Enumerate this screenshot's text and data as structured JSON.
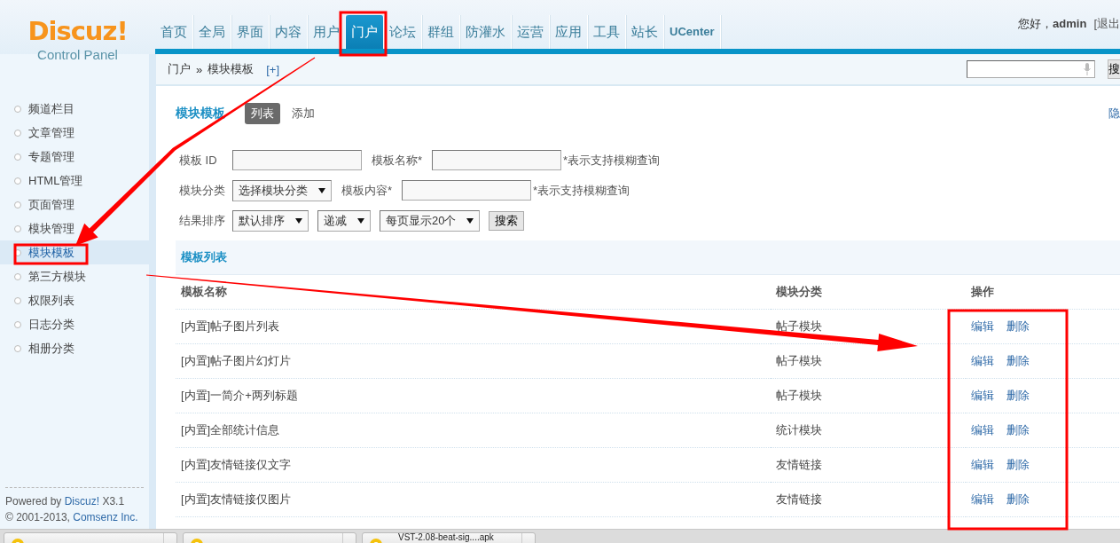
{
  "logo": {
    "title": "Discuz!",
    "subtitle": "Control Panel"
  },
  "nav": [
    {
      "label": "首页",
      "selected": false
    },
    {
      "label": "全局",
      "selected": false
    },
    {
      "label": "界面",
      "selected": false
    },
    {
      "label": "内容",
      "selected": false
    },
    {
      "label": "用户",
      "selected": false
    },
    {
      "label": "门户",
      "selected": true
    },
    {
      "label": "论坛",
      "selected": false
    },
    {
      "label": "群组",
      "selected": false
    },
    {
      "label": "防灌水",
      "selected": false
    },
    {
      "label": "运营",
      "selected": false
    },
    {
      "label": "应用",
      "selected": false
    },
    {
      "label": "工具",
      "selected": false
    },
    {
      "label": "站长",
      "selected": false
    },
    {
      "label": "UCenter",
      "selected": false
    }
  ],
  "user": {
    "greeting": "您好，",
    "name": "admin",
    "logout": "[退出"
  },
  "breadcrumb": {
    "items": [
      "门户",
      "模块模板"
    ],
    "separator": "»",
    "add": "[+]"
  },
  "top_search": {
    "button": "搜"
  },
  "sidebar": {
    "items": [
      {
        "label": "频道栏目",
        "selected": false
      },
      {
        "label": "文章管理",
        "selected": false
      },
      {
        "label": "专题管理",
        "selected": false
      },
      {
        "label": "HTML管理",
        "selected": false
      },
      {
        "label": "页面管理",
        "selected": false
      },
      {
        "label": "模块管理",
        "selected": false
      },
      {
        "label": "模块模板",
        "selected": true
      },
      {
        "label": "第三方模块",
        "selected": false
      },
      {
        "label": "权限列表",
        "selected": false
      },
      {
        "label": "日志分类",
        "selected": false
      },
      {
        "label": "相册分类",
        "selected": false
      }
    ],
    "footer": {
      "powered": "Powered by ",
      "product": "Discuz!",
      "version": " X3.1",
      "copyright": "© 2001-2013, ",
      "company": "Comsenz Inc."
    }
  },
  "page": {
    "title": "模块模板",
    "tabs": [
      {
        "label": "列表",
        "selected": true
      },
      {
        "label": "添加",
        "selected": false
      }
    ],
    "side_link": "隐"
  },
  "filters": [
    {
      "fields": [
        {
          "kind": "label",
          "text": "模板 ID"
        },
        {
          "kind": "input"
        },
        {
          "kind": "label",
          "text": "模板名称*"
        },
        {
          "kind": "input"
        },
        {
          "kind": "hint",
          "text": "*表示支持模糊查询"
        }
      ]
    },
    {
      "fields": [
        {
          "kind": "label",
          "text": "模块分类"
        },
        {
          "kind": "select",
          "value": "选择模块分类"
        },
        {
          "kind": "label",
          "text": "模板内容*"
        },
        {
          "kind": "input"
        },
        {
          "kind": "hint",
          "text": "*表示支持模糊查询"
        }
      ]
    },
    {
      "fields": [
        {
          "kind": "label",
          "text": "结果排序"
        },
        {
          "kind": "select",
          "value": "默认排序"
        },
        {
          "kind": "select",
          "value": "递减"
        },
        {
          "kind": "select",
          "value": "每页显示20个"
        },
        {
          "kind": "button",
          "text": "搜索"
        }
      ]
    }
  ],
  "table": {
    "caption": "模板列表",
    "columns": [
      "模板名称",
      "模块分类",
      "操作"
    ],
    "rows": [
      {
        "name": "[内置]帖子图片列表",
        "category": "帖子模块",
        "actions": [
          "编辑",
          "删除"
        ]
      },
      {
        "name": "[内置]帖子图片幻灯片",
        "category": "帖子模块",
        "actions": [
          "编辑",
          "删除"
        ]
      },
      {
        "name": "[内置]一简介+两列标题",
        "category": "帖子模块",
        "actions": [
          "编辑",
          "删除"
        ]
      },
      {
        "name": "[内置]全部统计信息",
        "category": "统计模块",
        "actions": [
          "编辑",
          "删除"
        ]
      },
      {
        "name": "[内置]友情链接仅文字",
        "category": "友情链接",
        "actions": [
          "编辑",
          "删除"
        ]
      },
      {
        "name": "[内置]友情链接仅图片",
        "category": "友情链接",
        "actions": [
          "编辑",
          "删除"
        ]
      }
    ]
  },
  "downloads": [
    {
      "kind": "download"
    },
    {
      "kind": "download"
    },
    {
      "kind": "download",
      "label": "VST-2.08-beat-sig....apk"
    }
  ],
  "annotations": [
    {
      "kind": "box"
    },
    {
      "kind": "box"
    },
    {
      "kind": "box"
    },
    {
      "kind": "arrow"
    },
    {
      "kind": "arrow"
    }
  ]
}
